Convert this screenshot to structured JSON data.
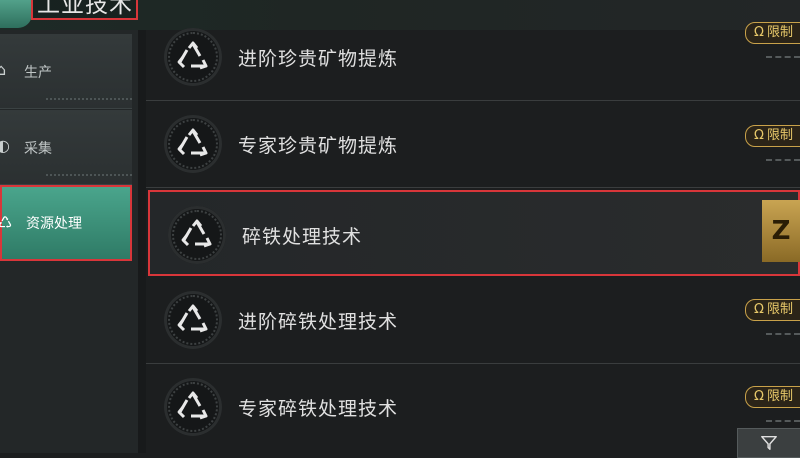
{
  "header": {
    "title": "工业技术"
  },
  "sidebar": {
    "items": [
      {
        "label": "生产",
        "icon": "factory-icon"
      },
      {
        "label": "采集",
        "icon": "gather-icon"
      },
      {
        "label": "资源处理",
        "icon": "resource-processing-icon",
        "active": true
      }
    ]
  },
  "list": {
    "items": [
      {
        "name": "进阶珍贵矿物提炼",
        "badge": "限制",
        "icon": "recycle-icon"
      },
      {
        "name": "专家珍贵矿物提炼",
        "badge": "限制",
        "icon": "recycle-icon"
      },
      {
        "name": "碎铁处理技术",
        "tile": "Z",
        "icon": "recycle-icon",
        "selected": true
      },
      {
        "name": "进阶碎铁处理技术",
        "badge": "限制",
        "icon": "recycle-icon"
      },
      {
        "name": "专家碎铁处理技术",
        "badge": "限制",
        "icon": "recycle-icon"
      }
    ]
  },
  "badge_symbol": "Ω",
  "colors": {
    "accent_green": "#3f9a80",
    "highlight_red": "#d8363a",
    "badge_gold": "#c9a24a"
  }
}
